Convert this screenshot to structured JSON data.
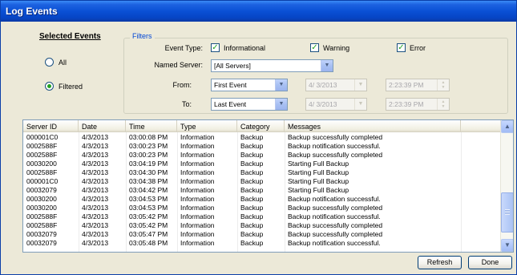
{
  "window": {
    "title": "Log Events"
  },
  "selected_events": {
    "title": "Selected Events",
    "options": [
      {
        "label": "All",
        "checked": false
      },
      {
        "label": "Filtered",
        "checked": true
      }
    ]
  },
  "filters": {
    "legend": "Filters",
    "event_type_label": "Event Type:",
    "event_types": [
      {
        "label": "Informational",
        "checked": true
      },
      {
        "label": "Warning",
        "checked": true
      },
      {
        "label": "Error",
        "checked": true
      }
    ],
    "named_server_label": "Named Server:",
    "named_server_value": "[All Servers]",
    "from_label": "From:",
    "from_value": "First Event",
    "from_date": "4/ 3/2013",
    "from_time": "2:23:39 PM",
    "to_label": "To:",
    "to_value": "Last Event",
    "to_date": "4/ 3/2013",
    "to_time": "2:23:39 PM"
  },
  "grid": {
    "columns": [
      "Server ID",
      "Date",
      "Time",
      "Type",
      "Category",
      "Messages"
    ],
    "rows": [
      [
        "000001C0",
        "4/3/2013",
        "03:00:08 PM",
        "Information",
        "Backup",
        "Backup successfully completed"
      ],
      [
        "0002588F",
        "4/3/2013",
        "03:00:23 PM",
        "Information",
        "Backup",
        "Backup notification successful."
      ],
      [
        "0002588F",
        "4/3/2013",
        "03:00:23 PM",
        "Information",
        "Backup",
        "Backup successfully completed"
      ],
      [
        "00030200",
        "4/3/2013",
        "03:04:19 PM",
        "Information",
        "Backup",
        "Starting Full Backup"
      ],
      [
        "0002588F",
        "4/3/2013",
        "03:04:30 PM",
        "Information",
        "Backup",
        "Starting Full Backup"
      ],
      [
        "000001C0",
        "4/3/2013",
        "03:04:38 PM",
        "Information",
        "Backup",
        "Starting Full Backup"
      ],
      [
        "00032079",
        "4/3/2013",
        "03:04:42 PM",
        "Information",
        "Backup",
        "Starting Full Backup"
      ],
      [
        "00030200",
        "4/3/2013",
        "03:04:53 PM",
        "Information",
        "Backup",
        "Backup notification successful."
      ],
      [
        "00030200",
        "4/3/2013",
        "03:04:53 PM",
        "Information",
        "Backup",
        "Backup successfully completed"
      ],
      [
        "0002588F",
        "4/3/2013",
        "03:05:42 PM",
        "Information",
        "Backup",
        "Backup notification successful."
      ],
      [
        "0002588F",
        "4/3/2013",
        "03:05:42 PM",
        "Information",
        "Backup",
        "Backup successfully completed"
      ],
      [
        "00032079",
        "4/3/2013",
        "03:05:47 PM",
        "Information",
        "Backup",
        "Backup successfully completed"
      ],
      [
        "00032079",
        "4/3/2013",
        "03:05:48 PM",
        "Information",
        "Backup",
        "Backup notification successful."
      ]
    ]
  },
  "buttons": {
    "refresh": "Refresh",
    "done": "Done"
  }
}
